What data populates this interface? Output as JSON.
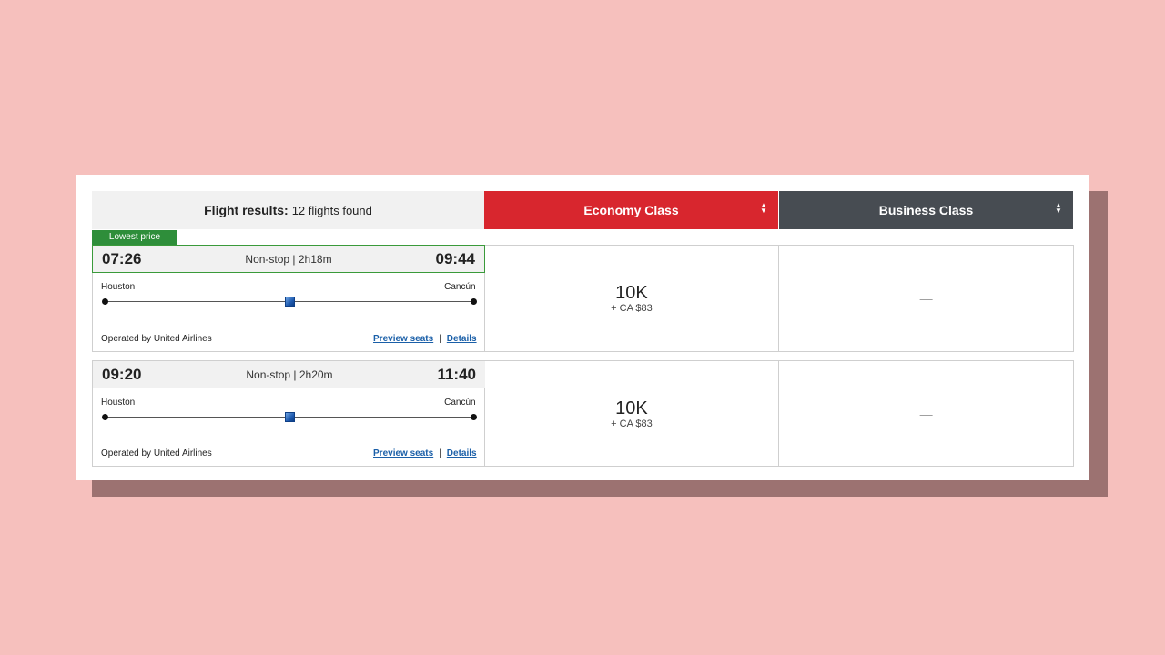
{
  "header": {
    "results_label": "Flight results:",
    "results_count": "12 flights found",
    "economy_label": "Economy Class",
    "business_label": "Business Class",
    "sort_icon": "sort-updown-icon"
  },
  "badge": {
    "label": "Lowest price"
  },
  "flights": [
    {
      "depart": "07:26",
      "arrive": "09:44",
      "meta": "Non-stop | 2h18m",
      "from": "Houston",
      "to": "Cancún",
      "operator": "Operated by United Airlines",
      "preview_label": "Preview seats",
      "details_label": "Details",
      "economy_points": "10K",
      "economy_fee": "+ CA $83",
      "business": "—"
    },
    {
      "depart": "09:20",
      "arrive": "11:40",
      "meta": "Non-stop | 2h20m",
      "from": "Houston",
      "to": "Cancún",
      "operator": "Operated by United Airlines",
      "preview_label": "Preview seats",
      "details_label": "Details",
      "economy_points": "10K",
      "economy_fee": "+ CA $83",
      "business": "—"
    }
  ],
  "colors": {
    "background": "#f6c0bd",
    "economy": "#d8262e",
    "business": "#474c52",
    "badge": "#2e8e3a",
    "link": "#1a5fa8"
  }
}
